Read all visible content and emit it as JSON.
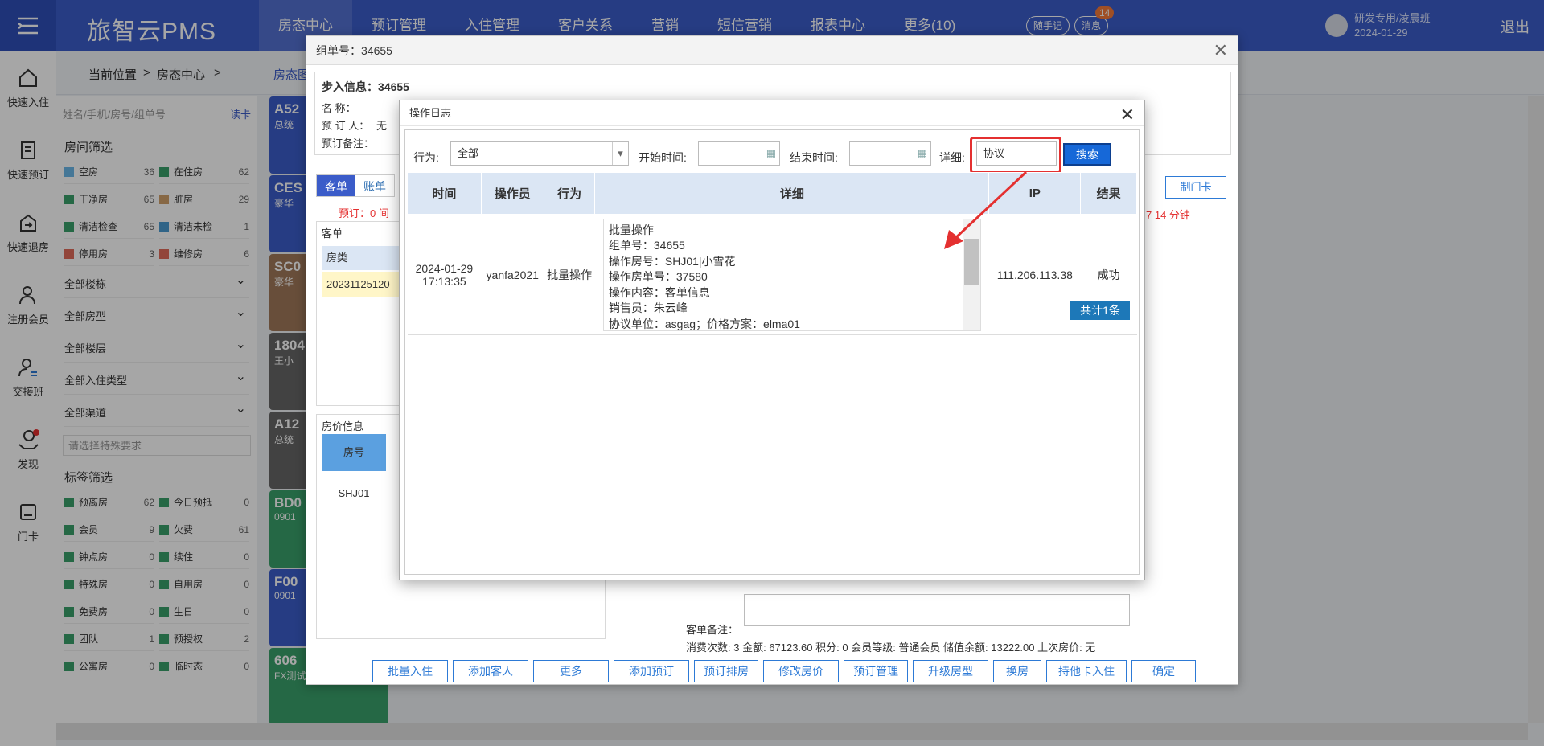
{
  "topbar": {
    "logo": "旅智云PMS",
    "nav": [
      "房态中心",
      "预订管理",
      "入住管理",
      "客户关系",
      "营销",
      "短信营销",
      "报表中心",
      "更多(10)"
    ],
    "notes": "随手记",
    "msg": "消息",
    "msg_count": "14",
    "user": "研发专用/凌晨班",
    "date": "2024-01-29",
    "logout": "退出"
  },
  "sidebar": [
    "快速入住",
    "快速预订",
    "快速退房",
    "注册会员",
    "交接班",
    "发现",
    "门卡"
  ],
  "breadcrumb": {
    "pos": "当前位置",
    "sep": ">",
    "page": "房态中心",
    "tab": "房态图"
  },
  "filter": {
    "placeholder": "姓名/手机/房号/组单号",
    "read": "读卡",
    "room_title": "房间筛选",
    "rooms": [
      [
        "空房",
        "36",
        "#6bb7e8"
      ],
      [
        "在住房",
        "62",
        "#3aa06a"
      ],
      [
        "干净房",
        "65",
        "#3aa06a"
      ],
      [
        "脏房",
        "29",
        "#cfa06b"
      ],
      [
        "清洁检查",
        "65",
        "#3aa06a"
      ],
      [
        "清洁未检",
        "1",
        "#4a9ad0"
      ],
      [
        "停用房",
        "3",
        "#e06b5a"
      ],
      [
        "维修房",
        "6",
        "#e06b5a"
      ]
    ],
    "drops": [
      "全部楼栋",
      "全部房型",
      "全部楼层",
      "全部入住类型",
      "全部渠道"
    ],
    "special": "请选择特殊要求",
    "tag_title": "标签筛选",
    "tags": [
      [
        "预离房",
        "62"
      ],
      [
        "今日预抵",
        "0"
      ],
      [
        "会员",
        "9"
      ],
      [
        "欠费",
        "61"
      ],
      [
        "钟点房",
        "0"
      ],
      [
        "续住",
        "0"
      ],
      [
        "特殊房",
        "0"
      ],
      [
        "自用房",
        "0"
      ],
      [
        "免费房",
        "0"
      ],
      [
        "生日",
        "0"
      ],
      [
        "团队",
        "1"
      ],
      [
        "预授权",
        "2"
      ],
      [
        "公寓房",
        "0"
      ],
      [
        "临时态",
        "0"
      ]
    ]
  },
  "rooms": [
    [
      "A52",
      "总统"
    ],
    [
      "CES",
      "豪华"
    ],
    [
      "SC0",
      "豪华"
    ],
    [
      "1804",
      "王小"
    ],
    [
      "A12",
      "总统"
    ],
    [
      "BD0",
      "0901"
    ],
    [
      "F00",
      "0901"
    ],
    [
      "606",
      "FX测试"
    ]
  ],
  "outer": {
    "title": "组单号：34655",
    "checkin": "步入信息：34655",
    "name_label": "名    称：",
    "booker_label": "预 订 人：",
    "booker": "无",
    "remark_label": "预订备注：",
    "tabs": [
      "客单",
      "账单"
    ],
    "booking_label": "预订：",
    "booking_val": "0 间",
    "guest_label": "客单",
    "type_label": "房类",
    "order_id": "20231125120",
    "price_label": "房价信息",
    "room_no_label": "房号",
    "room_no": "SHJ01",
    "make_card": "制门卡",
    "remaining": "7 14 分钟",
    "bottom_remark": "客单备注：",
    "stats": "消费次数: 3  金额: 67123.60  积分: 0  会员等级: 普通会员  储值余额: 13222.00  上次房价: 无",
    "buttons": [
      "批量入住",
      "添加客人",
      "更多",
      "添加预订",
      "预订排房",
      "修改房价",
      "预订管理",
      "升级房型",
      "换房",
      "持他卡入住",
      "确定"
    ]
  },
  "inner": {
    "title": "操作日志",
    "action_label": "行为:",
    "action_val": "全部",
    "start_label": "开始时间:",
    "end_label": "结束时间:",
    "detail_label": "详细:",
    "detail_val": "协议",
    "search": "搜索",
    "headers": [
      "时间",
      "操作员",
      "行为",
      "详细",
      "IP",
      "结果"
    ],
    "row": {
      "time": "2024-01-29 17:13:35",
      "op": "yanfa2021",
      "act": "批量操作",
      "detail": [
        "批量操作",
        "组单号：34655",
        "操作房号：SHJ01|小雪花",
        "操作房单号：37580",
        "操作内容：客单信息",
        "销售员：朱云峰",
        "协议单位：asgag；价格方案：elma01"
      ],
      "ip": "111.206.113.38",
      "result": "成功"
    },
    "total": "共计1条"
  }
}
